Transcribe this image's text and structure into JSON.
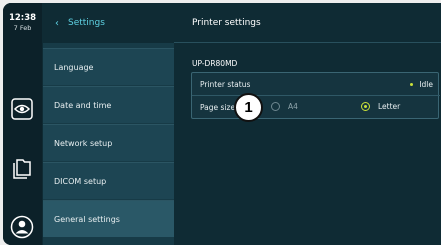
{
  "clock": {
    "time": "12:38",
    "date": "7 Feb"
  },
  "rail": {
    "icons": [
      "eye-icon",
      "files-icon",
      "user-icon"
    ]
  },
  "menu": {
    "back_label": "Settings",
    "items": [
      {
        "label": "Language"
      },
      {
        "label": "Date and time"
      },
      {
        "label": "Network setup"
      },
      {
        "label": "DICOM setup"
      },
      {
        "label": "General settings"
      }
    ]
  },
  "content": {
    "title": "Printer settings",
    "model": "UP-DR80MD",
    "printer_status_label": "Printer status",
    "printer_status_value": "Idle",
    "page_size_label": "Page size",
    "options": [
      {
        "label": "A4",
        "selected": false
      },
      {
        "label": "Letter",
        "selected": true
      }
    ]
  },
  "callout": {
    "number": "1"
  },
  "colors": {
    "accent": "#5ed1e2",
    "status_dot": "#c9e03a",
    "background": "#0f2b34"
  }
}
